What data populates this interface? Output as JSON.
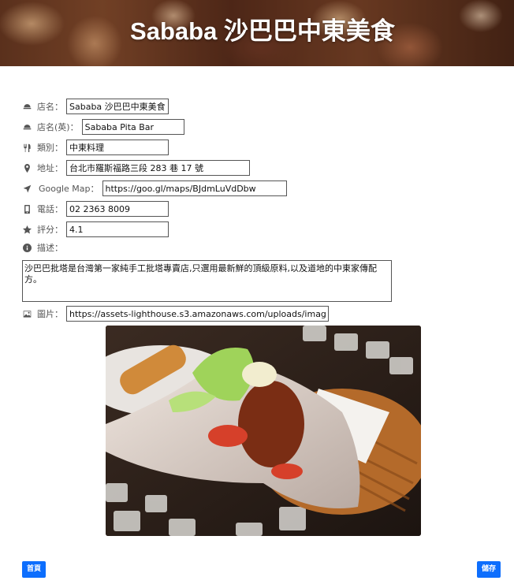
{
  "header": {
    "title": "Sababa 沙巴巴中東美食"
  },
  "form": {
    "name": {
      "label": "店名：",
      "value": "Sababa 沙巴巴中東美食",
      "icon": "dome-icon"
    },
    "name_en": {
      "label": "店名(英)：",
      "value": "Sababa Pita Bar",
      "icon": "dome-icon"
    },
    "category": {
      "label": "類別：",
      "value": "中東料理",
      "icon": "utensils-icon"
    },
    "address": {
      "label": "地址：",
      "value": "台北市羅斯福路三段 283 巷 17 號",
      "icon": "map-marker-icon"
    },
    "google_map": {
      "label": "Google Map：",
      "value": "https://goo.gl/maps/BJdmLuVdDbw",
      "icon": "location-arrow-icon"
    },
    "phone": {
      "label": "電話：",
      "value": "02 2363 8009",
      "icon": "mobile-icon"
    },
    "rating": {
      "label": "評分：",
      "value": "4.1",
      "icon": "star-icon"
    },
    "description": {
      "label": "描述：",
      "value": "沙巴巴批塔是台灣第一家純手工批塔專賣店,只選用最新鮮的頂級原料,以及道地的中東家傳配方。",
      "icon": "info-circle-icon"
    },
    "image": {
      "label": "圖片：",
      "value": "https://assets-lighthouse.s3.amazonaws.com/uploads/image/file/563",
      "icon": "image-icon"
    }
  },
  "buttons": {
    "home": "首頁",
    "save": "儲存"
  },
  "colors": {
    "primary": "#0d6efd"
  }
}
